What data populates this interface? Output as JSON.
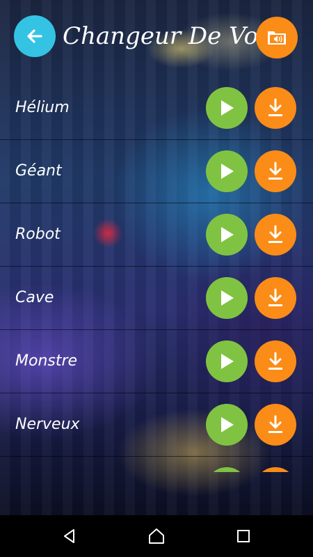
{
  "header": {
    "title": "Changeur De Voix",
    "back_icon": "arrow-left-icon",
    "folder_icon": "audio-folder-icon"
  },
  "colors": {
    "back_button": "#35c3e4",
    "play_button": "#80c342",
    "download_button": "#fb8c17",
    "navbar": "#000000"
  },
  "effects": [
    {
      "label": "Hélium"
    },
    {
      "label": "Géant"
    },
    {
      "label": "Robot"
    },
    {
      "label": "Cave"
    },
    {
      "label": "Monstre"
    },
    {
      "label": "Nerveux"
    },
    {
      "label": ""
    }
  ],
  "navbar": {
    "icons": [
      "back-triangle-icon",
      "home-icon",
      "recents-square-icon"
    ]
  }
}
